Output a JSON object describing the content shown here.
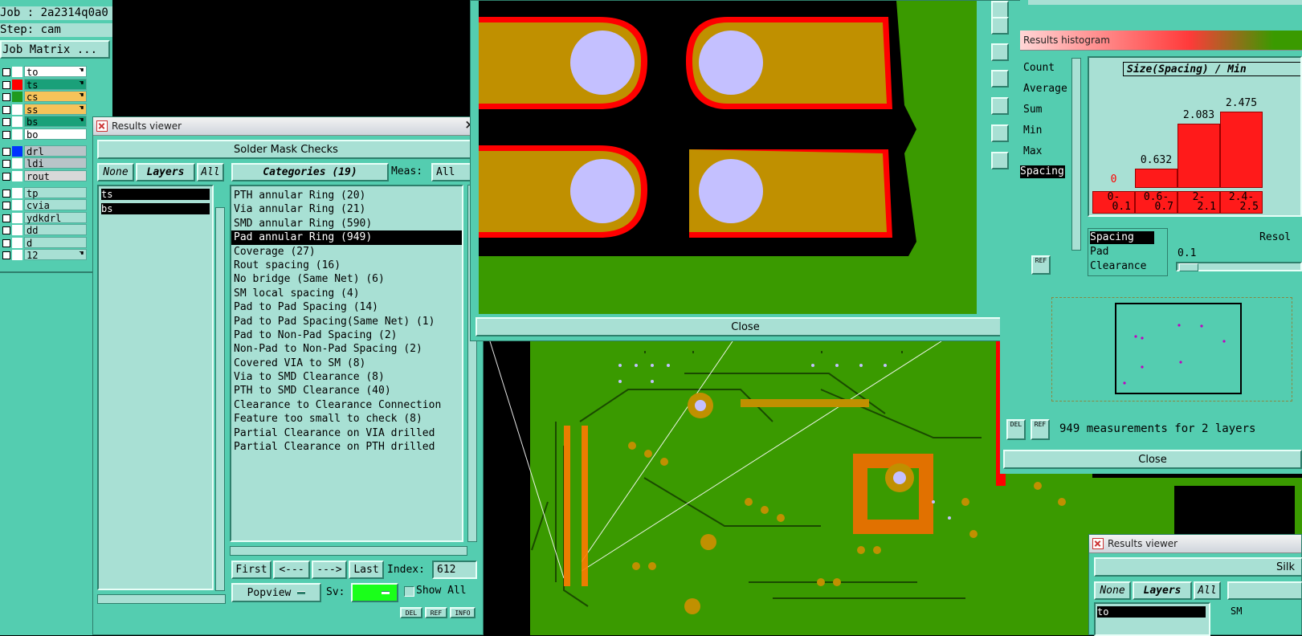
{
  "job": {
    "job_line": "Job : 2a2314q0a0",
    "step_line": "Step: cam",
    "matrix_button": "Job Matrix ..."
  },
  "layers": [
    {
      "name": "to",
      "color": "#ffffff",
      "swatch": "#ffffff",
      "hand": true
    },
    {
      "name": "ts",
      "color": "#1aa079",
      "swatch": "#ff0000",
      "hand": true
    },
    {
      "name": "cs",
      "color": "#f6c35a",
      "swatch": "#1f9a1f",
      "hand": true
    },
    {
      "name": "ss",
      "color": "#f6c35a",
      "swatch": "#ffffff",
      "hand": true
    },
    {
      "name": "bs",
      "color": "#1aa079",
      "swatch": "#ffffff",
      "hand": true
    },
    {
      "name": "bo",
      "color": "#ffffff",
      "swatch": "#ffffff",
      "hand": false
    },
    {
      "name": "drl",
      "color": "#b8c4c8",
      "swatch": "#0033ff",
      "hand": false
    },
    {
      "name": "ldi",
      "color": "#b8c4c8",
      "swatch": "#ffffff",
      "hand": false
    },
    {
      "name": "rout",
      "color": "#d8d8d8",
      "swatch": "#ffffff",
      "hand": false
    },
    {
      "name": "tp",
      "color": "#a8e0d4",
      "swatch": "#ffffff",
      "hand": false
    },
    {
      "name": "cvia",
      "color": "#a8e0d4",
      "swatch": "#ffffff",
      "hand": false
    },
    {
      "name": "ydkdrl",
      "color": "#a8e0d4",
      "swatch": "#ffffff",
      "hand": false
    },
    {
      "name": "dd",
      "color": "#a8e0d4",
      "swatch": "#ffffff",
      "hand": false
    },
    {
      "name": "d",
      "color": "#a8e0d4",
      "swatch": "#ffffff",
      "hand": false
    },
    {
      "name": "12",
      "color": "#a8e0d4",
      "swatch": "#ffffff",
      "hand": true
    }
  ],
  "results_viewer": {
    "title": "Results viewer",
    "header": "Solder Mask Checks",
    "none_btn": "None",
    "layers_btn": "Layers",
    "all_btn": "All",
    "layer_items": [
      "ts",
      "bs"
    ],
    "categories_btn": "Categories (19)",
    "meas_label": "Meas:",
    "meas_value": "All",
    "categories": [
      "PTH annular Ring (20)",
      "Via annular Ring (21)",
      "SMD annular Ring (590)",
      "Pad annular Ring (949)",
      "Coverage (27)",
      "Rout spacing (16)",
      "No bridge (Same Net) (6)",
      "SM local spacing (4)",
      "Pad to Pad Spacing (14)",
      "Pad to Pad Spacing(Same Net) (1)",
      "Pad to Non-Pad Spacing (2)",
      "Non-Pad to Non-Pad Spacing (2)",
      "Covered VIA to SM (8)",
      "Via to SMD Clearance (8)",
      "PTH to SMD Clearance (40)",
      "Clearance to Clearance Connection",
      "Feature too small to check (8)",
      "Partial Clearance on VIA drilled",
      "Partial Clearance on PTH drilled"
    ],
    "selected_category": 3,
    "first_btn": "First",
    "prev_btn": "<---",
    "next_btn": "--->",
    "last_btn": "Last",
    "index_label": "Index:",
    "index_value": "612",
    "popview_btn": "Popview",
    "sv_label": "Sv:",
    "show_all_label": "Show All",
    "del_btn": "DEL",
    "ref_btn": "REF",
    "info_btn": "INFO"
  },
  "zoom_window": {
    "close_btn": "Close"
  },
  "histogram": {
    "title": "Results histogram",
    "stats": [
      "Count",
      "Average",
      "Sum",
      "Min",
      "Max"
    ],
    "chart_title": "Size(Spacing) / Min",
    "selected_stat": "Spacing",
    "list_items": [
      "Spacing",
      "Pad",
      "Clearance"
    ],
    "resol_label": "Resol",
    "resol_value": "0.1",
    "status": "949 measurements for 2 layers",
    "close_btn": "Close",
    "del_btn": "DEL",
    "ref_btn": "REF"
  },
  "chart_data": {
    "type": "bar",
    "title": "Size(Spacing) / Min",
    "categories": [
      "0-0.1",
      "0.6-0.7",
      "2-2.1",
      "2.4-2.5"
    ],
    "values": [
      0,
      0.632,
      2.083,
      2.475
    ],
    "value_labels": [
      "0",
      "0.632",
      "2.083",
      "2.475"
    ],
    "xtick_top": [
      "0-",
      "0.6-",
      "2-",
      "2.4-"
    ],
    "xtick_bottom": [
      "0.1",
      "0.7",
      "2.1",
      "2.5"
    ],
    "ylim": [
      0,
      2.6
    ],
    "colors": {
      "bar": "#ff1a1a",
      "zero_label": "#ff0000"
    }
  },
  "results_viewer2": {
    "title": "Results viewer",
    "header": "Silk",
    "none_btn": "None",
    "layers_btn": "Layers",
    "all_btn": "All",
    "first_item": "to",
    "extra": "SM"
  },
  "colors": {
    "panel": "#54cdb0",
    "field": "#a8e0d4",
    "board_green": "#3a9a00",
    "pad_gold": "#c09000",
    "mask_red": "#ff0000",
    "drill": "#c4c0ff"
  }
}
